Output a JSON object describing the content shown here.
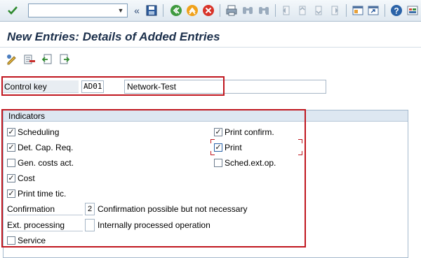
{
  "toolbar": {
    "command_value": "",
    "icons": [
      "check-icon",
      "double-left-icon",
      "save-icon",
      "back-icon",
      "exit-icon",
      "cancel-icon",
      "print-icon",
      "find-icon",
      "find-next-icon",
      "first-page-icon",
      "prev-page-icon",
      "next-page-icon",
      "last-page-icon",
      "create-session-icon",
      "shortcut-icon",
      "help-icon",
      "customize-layout-icon"
    ]
  },
  "title": "New Entries: Details of Added Entries",
  "app_toolbar": {
    "icons": [
      "display-change-icon",
      "delete-icon",
      "previous-entry-icon",
      "next-entry-icon"
    ]
  },
  "control_key": {
    "label": "Control key",
    "value": "AD01",
    "description": "Network-Test"
  },
  "indicators": {
    "title": "Indicators",
    "left_checks": [
      {
        "label": "Scheduling",
        "checked": true
      },
      {
        "label": "Det. Cap. Req.",
        "checked": true
      },
      {
        "label": "Gen. costs act.",
        "checked": false
      },
      {
        "label": "Cost",
        "checked": true
      },
      {
        "label": "Print time tic.",
        "checked": true
      }
    ],
    "right_checks": [
      {
        "label": "Print confirm.",
        "checked": true
      },
      {
        "label": "Print",
        "checked": true
      },
      {
        "label": "Sched.ext.op.",
        "checked": false
      }
    ],
    "confirmation": {
      "label": "Confirmation",
      "value": "2",
      "text": "Confirmation possible but not necessary"
    },
    "ext_processing": {
      "label": "Ext. processing",
      "value": "",
      "text": "Internally processed operation"
    },
    "service": {
      "label": "Service",
      "checked": false
    }
  },
  "colors": {
    "highlight_red": "#c0171f",
    "title_text": "#1b2f4b"
  }
}
